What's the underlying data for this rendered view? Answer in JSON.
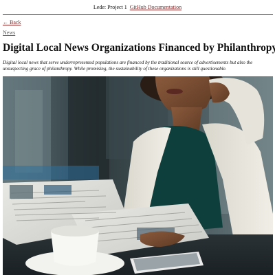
{
  "nav": {
    "project_label": "Lede: Project 1",
    "docs_link": "GitHub Documentation"
  },
  "back_link": "← Back",
  "breadcrumb": "News",
  "article": {
    "headline": "Digital Local News Organizations Financed by Philanthropy",
    "dek": "Digital local news that serve underrepresented populations are financed by the traditional source of advertisements but also the unsuspecting grace of philanthropy. While promising, the sustainability of these organizations is still questionable."
  },
  "colors": {
    "link": "#8b1a1a",
    "rule": "#8b1a1a"
  }
}
